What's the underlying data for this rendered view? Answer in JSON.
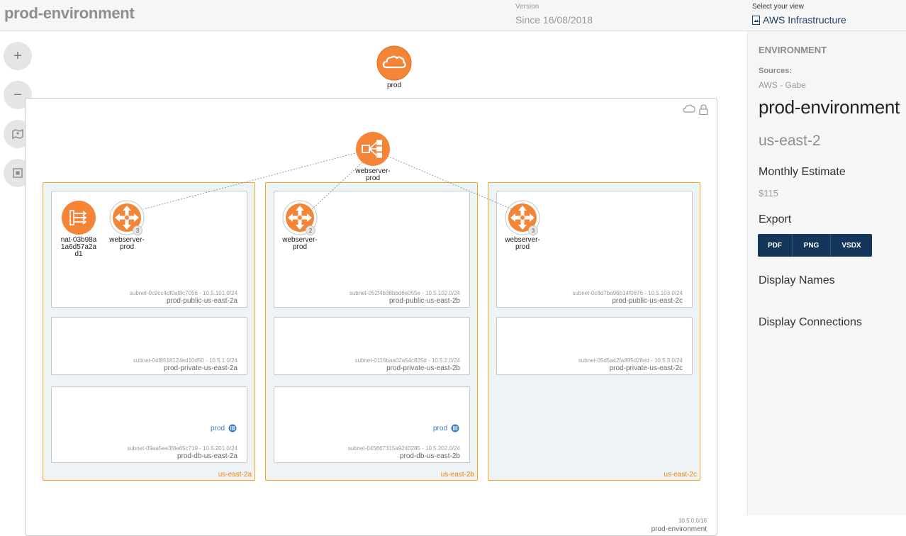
{
  "header": {
    "title": "prod-environment",
    "version_label": "Version",
    "version_value": "Since 16/08/2018",
    "view_label": "Select your view",
    "view_value": "AWS Infrastructure"
  },
  "toolbar": {
    "zoom_in": "+",
    "zoom_out": "−"
  },
  "diagram": {
    "cloud_label": "prod",
    "load_balancer_label": "webserver-prod",
    "vpc": {
      "cidr": "10.5.0.0/16",
      "name": "prod-environment"
    },
    "azs": [
      {
        "label": "us-east-2a",
        "subnets": [
          {
            "id": "subnet-0c9cc4df0af8c7056 - 10.5.101.0/24",
            "name": "prod-public-us-east-2a"
          },
          {
            "id": "subnet-04f8518124ed10d50 - 10.5.1.0/24",
            "name": "prod-private-us-east-2a"
          },
          {
            "id": "subnet-09aa5ee3f8e65c719 - 10.5.201.0/24",
            "name": "prod-db-us-east-2a",
            "db": "prod"
          }
        ],
        "nat": {
          "label": "nat-03b98a1a6d57a2ad1"
        },
        "asg": {
          "label": "webserver-prod",
          "count": "3"
        }
      },
      {
        "label": "us-east-2b",
        "subnets": [
          {
            "id": "subnet-052f4b38bbd6e055e - 10.5.102.0/24",
            "name": "prod-public-us-east-2b"
          },
          {
            "id": "subnet-0116baa02a54c825d - 10.5.2.0/24",
            "name": "prod-private-us-east-2b"
          },
          {
            "id": "subnet-045667315a9240285 - 10.5.202.0/24",
            "name": "prod-db-us-east-2b",
            "db": "prod"
          }
        ],
        "asg": {
          "label": "webserver-prod",
          "count": "2"
        }
      },
      {
        "label": "us-east-2c",
        "subnets": [
          {
            "id": "subnet-0c8d7ba96b14f0676 - 10.5.103.0/24",
            "name": "prod-public-us-east-2c"
          },
          {
            "id": "subnet-05d5a42fa895d28ed - 10.5.3.0/24",
            "name": "prod-private-us-east-2c"
          }
        ],
        "asg": {
          "label": "webserver-prod",
          "count": "3"
        }
      }
    ]
  },
  "panel": {
    "heading": "ENVIRONMENT",
    "sources_label": "Sources:",
    "sources_value": "AWS - Gabe",
    "env_name": "prod-environment",
    "region": "us-east-2",
    "estimate_label": "Monthly Estimate",
    "estimate_value": "$115",
    "export_label": "Export",
    "export_buttons": [
      "PDF",
      "PNG",
      "VSDX"
    ],
    "display_names": "Display Names",
    "display_connections": "Display Connections"
  },
  "colors": {
    "aws_orange": "#f58536",
    "az_border": "#f5a623",
    "export_bg": "#14365a",
    "link_blue": "#1c3f66"
  }
}
